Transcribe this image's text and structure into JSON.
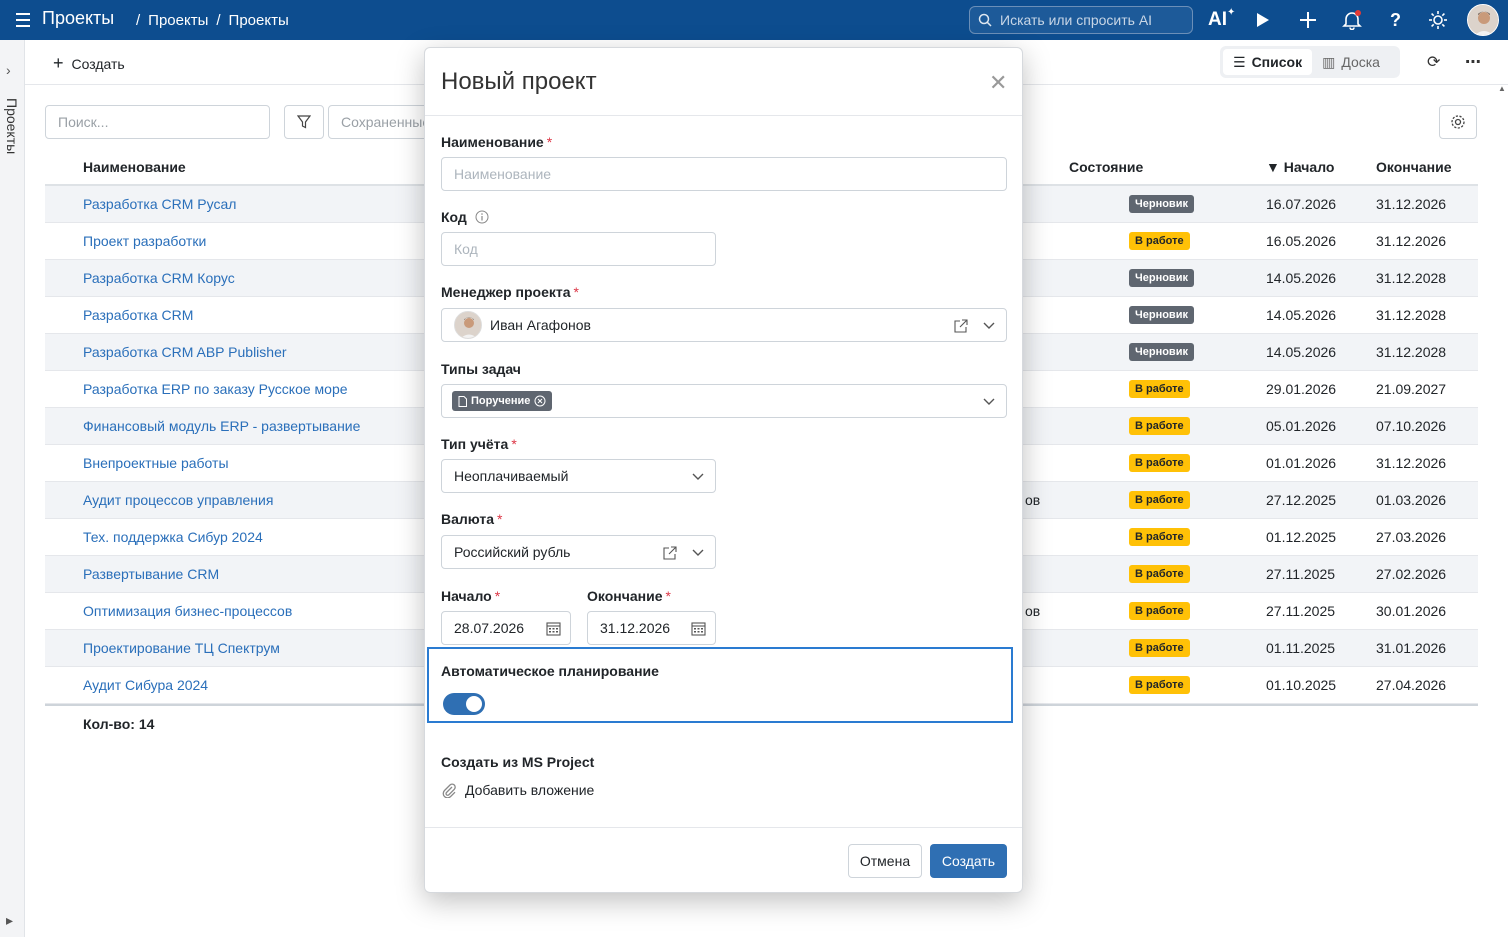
{
  "topbar": {
    "app_title": "Проекты",
    "crumbs": [
      "/",
      "Проекты",
      "/",
      "Проекты"
    ],
    "search_placeholder": "Искать или спросить AI",
    "ai_label": "AI"
  },
  "rail": {
    "label": "Проекты"
  },
  "toolbar": {
    "create_label": "Создать",
    "views": [
      {
        "label": "Список",
        "active": true
      },
      {
        "label": "Доска",
        "active": false
      }
    ]
  },
  "filters": {
    "search_placeholder": "Поиск...",
    "saved_label": "Сохраненные фильтры"
  },
  "table": {
    "headers": {
      "name": "Наименование",
      "state": "Состояние",
      "start": "▼ Начало",
      "end": "Окончание"
    },
    "rows": [
      {
        "name": "Разработка CRM Русал",
        "extra": "",
        "state": "Черновик",
        "state_kind": "draft",
        "start": "16.07.2026",
        "end": "31.12.2026"
      },
      {
        "name": "Проект разработки",
        "extra": "",
        "state": "В работе",
        "state_kind": "work",
        "start": "16.05.2026",
        "end": "31.12.2026"
      },
      {
        "name": "Разработка CRM Корус",
        "extra": "",
        "state": "Черновик",
        "state_kind": "draft",
        "start": "14.05.2026",
        "end": "31.12.2028"
      },
      {
        "name": "Разработка CRM",
        "extra": "",
        "state": "Черновик",
        "state_kind": "draft",
        "start": "14.05.2026",
        "end": "31.12.2028"
      },
      {
        "name": "Разработка CRM ABP Publisher",
        "extra": "",
        "state": "Черновик",
        "state_kind": "draft",
        "start": "14.05.2026",
        "end": "31.12.2028"
      },
      {
        "name": "Разработка ERP по заказу Русское море",
        "extra": "",
        "state": "В работе",
        "state_kind": "work",
        "start": "29.01.2026",
        "end": "21.09.2027"
      },
      {
        "name": "Финансовый модуль ERP - развертывание",
        "extra": "",
        "state": "В работе",
        "state_kind": "work",
        "start": "05.01.2026",
        "end": "07.10.2026"
      },
      {
        "name": "Внепроектные работы",
        "extra": "",
        "state": "В работе",
        "state_kind": "work",
        "start": "01.01.2026",
        "end": "31.12.2026"
      },
      {
        "name": "Аудит процессов управления",
        "extra": "ов",
        "state": "В работе",
        "state_kind": "work",
        "start": "27.12.2025",
        "end": "01.03.2026"
      },
      {
        "name": "Тех. поддержка Сибур 2024",
        "extra": "",
        "state": "В работе",
        "state_kind": "work",
        "start": "01.12.2025",
        "end": "27.03.2026"
      },
      {
        "name": "Развертывание CRM",
        "extra": "",
        "state": "В работе",
        "state_kind": "work",
        "start": "27.11.2025",
        "end": "27.02.2026"
      },
      {
        "name": "Оптимизация бизнес-процессов",
        "extra": "ов",
        "state": "В работе",
        "state_kind": "work",
        "start": "27.11.2025",
        "end": "30.01.2026"
      },
      {
        "name": "Проектирование ТЦ Спектрум",
        "extra": "",
        "state": "В работе",
        "state_kind": "work",
        "start": "01.11.2025",
        "end": "31.01.2026"
      },
      {
        "name": "Аудит Сибура 2024",
        "extra": "",
        "state": "В работе",
        "state_kind": "work",
        "start": "01.10.2025",
        "end": "27.04.2026"
      }
    ],
    "count_label": "Кол-во: 14"
  },
  "modal": {
    "title": "Новый проект",
    "name_label": "Наименование",
    "name_placeholder": "Наименование",
    "code_label": "Код",
    "code_placeholder": "Код",
    "manager_label": "Менеджер проекта",
    "manager_value": "Иван Агафонов",
    "task_types_label": "Типы задач",
    "task_type_tag": "Поручение",
    "accounting_label": "Тип учёта",
    "accounting_value": "Неоплачиваемый",
    "currency_label": "Валюта",
    "currency_value": "Российский рубль",
    "start_label": "Начало",
    "start_value": "28.07.2026",
    "end_label": "Окончание",
    "end_value": "31.12.2026",
    "auto_plan_label": "Автоматическое планирование",
    "auto_plan_on": true,
    "ms_project_label": "Создать из MS Project",
    "attach_label": "Добавить вложение",
    "cancel_label": "Отмена",
    "create_label": "Создать"
  },
  "colors": {
    "topbar": "#0d4d8f",
    "accent": "#2f6fb3",
    "link": "#2a6fba",
    "badge_draft": "#5f6670",
    "badge_work": "#ffc107",
    "required": "#dc3545"
  }
}
